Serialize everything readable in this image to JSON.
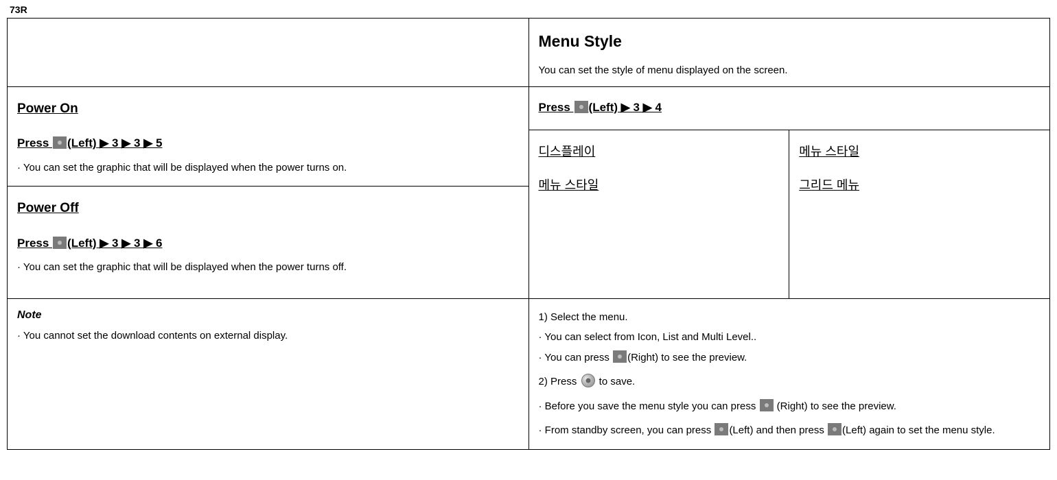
{
  "page_label": "73R",
  "left": {
    "power_on": {
      "heading": "Power On",
      "press_prefix": "Press ",
      "press_suffix": "(Left) ▶ 3 ▶ 3 ▶ 5",
      "body": "· You can set the graphic that will be displayed when the power turns on."
    },
    "power_off": {
      "heading": "Power Off",
      "press_prefix": "Press ",
      "press_suffix": "(Left) ▶ 3 ▶ 3 ▶ 6",
      "body": "· You can set the graphic that will be displayed when the power turns off."
    },
    "note": {
      "label": "Note",
      "body": "· You cannot set the download contents on external display."
    }
  },
  "right": {
    "title": "Menu Style",
    "subtitle": "You can set the style of menu displayed on the screen.",
    "press_prefix": "Press ",
    "press_suffix": "(Left) ▶ 3 ▶ 4",
    "kor_left": {
      "line1": "디스플레이",
      "line2": "메뉴 스타일"
    },
    "kor_right": {
      "line1": "메뉴 스타일",
      "line2": "그리드 메뉴"
    },
    "steps": {
      "s1": "1) Select the menu.",
      "s1a": "· You can select from Icon, List and Multi Level..",
      "s1b_pre": "· You can press ",
      "s1b_post": "(Right) to see the preview.",
      "s2_pre": "2) Press ",
      "s2_post": " to save.",
      "s3_pre": "· Before you save the menu style you can press ",
      "s3_post": " (Right) to see the preview.",
      "s4_pre": "· From standby screen, you can press ",
      "s4_mid": "(Left) and then press ",
      "s4_post": "(Left) again to set the menu style."
    }
  }
}
